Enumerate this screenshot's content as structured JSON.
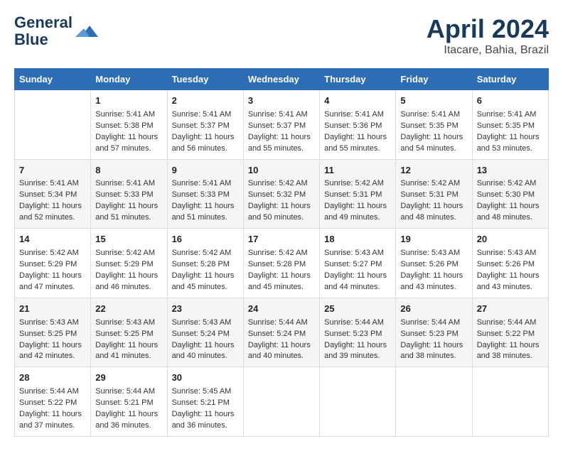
{
  "header": {
    "logo_line1": "General",
    "logo_line2": "Blue",
    "month_year": "April 2024",
    "location": "Itacare, Bahia, Brazil"
  },
  "columns": [
    "Sunday",
    "Monday",
    "Tuesday",
    "Wednesday",
    "Thursday",
    "Friday",
    "Saturday"
  ],
  "weeks": [
    [
      {
        "day": "",
        "sunrise": "",
        "sunset": "",
        "daylight": ""
      },
      {
        "day": "1",
        "sunrise": "Sunrise: 5:41 AM",
        "sunset": "Sunset: 5:38 PM",
        "daylight": "Daylight: 11 hours and 57 minutes."
      },
      {
        "day": "2",
        "sunrise": "Sunrise: 5:41 AM",
        "sunset": "Sunset: 5:37 PM",
        "daylight": "Daylight: 11 hours and 56 minutes."
      },
      {
        "day": "3",
        "sunrise": "Sunrise: 5:41 AM",
        "sunset": "Sunset: 5:37 PM",
        "daylight": "Daylight: 11 hours and 55 minutes."
      },
      {
        "day": "4",
        "sunrise": "Sunrise: 5:41 AM",
        "sunset": "Sunset: 5:36 PM",
        "daylight": "Daylight: 11 hours and 55 minutes."
      },
      {
        "day": "5",
        "sunrise": "Sunrise: 5:41 AM",
        "sunset": "Sunset: 5:35 PM",
        "daylight": "Daylight: 11 hours and 54 minutes."
      },
      {
        "day": "6",
        "sunrise": "Sunrise: 5:41 AM",
        "sunset": "Sunset: 5:35 PM",
        "daylight": "Daylight: 11 hours and 53 minutes."
      }
    ],
    [
      {
        "day": "7",
        "sunrise": "Sunrise: 5:41 AM",
        "sunset": "Sunset: 5:34 PM",
        "daylight": "Daylight: 11 hours and 52 minutes."
      },
      {
        "day": "8",
        "sunrise": "Sunrise: 5:41 AM",
        "sunset": "Sunset: 5:33 PM",
        "daylight": "Daylight: 11 hours and 51 minutes."
      },
      {
        "day": "9",
        "sunrise": "Sunrise: 5:41 AM",
        "sunset": "Sunset: 5:33 PM",
        "daylight": "Daylight: 11 hours and 51 minutes."
      },
      {
        "day": "10",
        "sunrise": "Sunrise: 5:42 AM",
        "sunset": "Sunset: 5:32 PM",
        "daylight": "Daylight: 11 hours and 50 minutes."
      },
      {
        "day": "11",
        "sunrise": "Sunrise: 5:42 AM",
        "sunset": "Sunset: 5:31 PM",
        "daylight": "Daylight: 11 hours and 49 minutes."
      },
      {
        "day": "12",
        "sunrise": "Sunrise: 5:42 AM",
        "sunset": "Sunset: 5:31 PM",
        "daylight": "Daylight: 11 hours and 48 minutes."
      },
      {
        "day": "13",
        "sunrise": "Sunrise: 5:42 AM",
        "sunset": "Sunset: 5:30 PM",
        "daylight": "Daylight: 11 hours and 48 minutes."
      }
    ],
    [
      {
        "day": "14",
        "sunrise": "Sunrise: 5:42 AM",
        "sunset": "Sunset: 5:29 PM",
        "daylight": "Daylight: 11 hours and 47 minutes."
      },
      {
        "day": "15",
        "sunrise": "Sunrise: 5:42 AM",
        "sunset": "Sunset: 5:29 PM",
        "daylight": "Daylight: 11 hours and 46 minutes."
      },
      {
        "day": "16",
        "sunrise": "Sunrise: 5:42 AM",
        "sunset": "Sunset: 5:28 PM",
        "daylight": "Daylight: 11 hours and 45 minutes."
      },
      {
        "day": "17",
        "sunrise": "Sunrise: 5:42 AM",
        "sunset": "Sunset: 5:28 PM",
        "daylight": "Daylight: 11 hours and 45 minutes."
      },
      {
        "day": "18",
        "sunrise": "Sunrise: 5:43 AM",
        "sunset": "Sunset: 5:27 PM",
        "daylight": "Daylight: 11 hours and 44 minutes."
      },
      {
        "day": "19",
        "sunrise": "Sunrise: 5:43 AM",
        "sunset": "Sunset: 5:26 PM",
        "daylight": "Daylight: 11 hours and 43 minutes."
      },
      {
        "day": "20",
        "sunrise": "Sunrise: 5:43 AM",
        "sunset": "Sunset: 5:26 PM",
        "daylight": "Daylight: 11 hours and 43 minutes."
      }
    ],
    [
      {
        "day": "21",
        "sunrise": "Sunrise: 5:43 AM",
        "sunset": "Sunset: 5:25 PM",
        "daylight": "Daylight: 11 hours and 42 minutes."
      },
      {
        "day": "22",
        "sunrise": "Sunrise: 5:43 AM",
        "sunset": "Sunset: 5:25 PM",
        "daylight": "Daylight: 11 hours and 41 minutes."
      },
      {
        "day": "23",
        "sunrise": "Sunrise: 5:43 AM",
        "sunset": "Sunset: 5:24 PM",
        "daylight": "Daylight: 11 hours and 40 minutes."
      },
      {
        "day": "24",
        "sunrise": "Sunrise: 5:44 AM",
        "sunset": "Sunset: 5:24 PM",
        "daylight": "Daylight: 11 hours and 40 minutes."
      },
      {
        "day": "25",
        "sunrise": "Sunrise: 5:44 AM",
        "sunset": "Sunset: 5:23 PM",
        "daylight": "Daylight: 11 hours and 39 minutes."
      },
      {
        "day": "26",
        "sunrise": "Sunrise: 5:44 AM",
        "sunset": "Sunset: 5:23 PM",
        "daylight": "Daylight: 11 hours and 38 minutes."
      },
      {
        "day": "27",
        "sunrise": "Sunrise: 5:44 AM",
        "sunset": "Sunset: 5:22 PM",
        "daylight": "Daylight: 11 hours and 38 minutes."
      }
    ],
    [
      {
        "day": "28",
        "sunrise": "Sunrise: 5:44 AM",
        "sunset": "Sunset: 5:22 PM",
        "daylight": "Daylight: 11 hours and 37 minutes."
      },
      {
        "day": "29",
        "sunrise": "Sunrise: 5:44 AM",
        "sunset": "Sunset: 5:21 PM",
        "daylight": "Daylight: 11 hours and 36 minutes."
      },
      {
        "day": "30",
        "sunrise": "Sunrise: 5:45 AM",
        "sunset": "Sunset: 5:21 PM",
        "daylight": "Daylight: 11 hours and 36 minutes."
      },
      {
        "day": "",
        "sunrise": "",
        "sunset": "",
        "daylight": ""
      },
      {
        "day": "",
        "sunrise": "",
        "sunset": "",
        "daylight": ""
      },
      {
        "day": "",
        "sunrise": "",
        "sunset": "",
        "daylight": ""
      },
      {
        "day": "",
        "sunrise": "",
        "sunset": "",
        "daylight": ""
      }
    ]
  ]
}
